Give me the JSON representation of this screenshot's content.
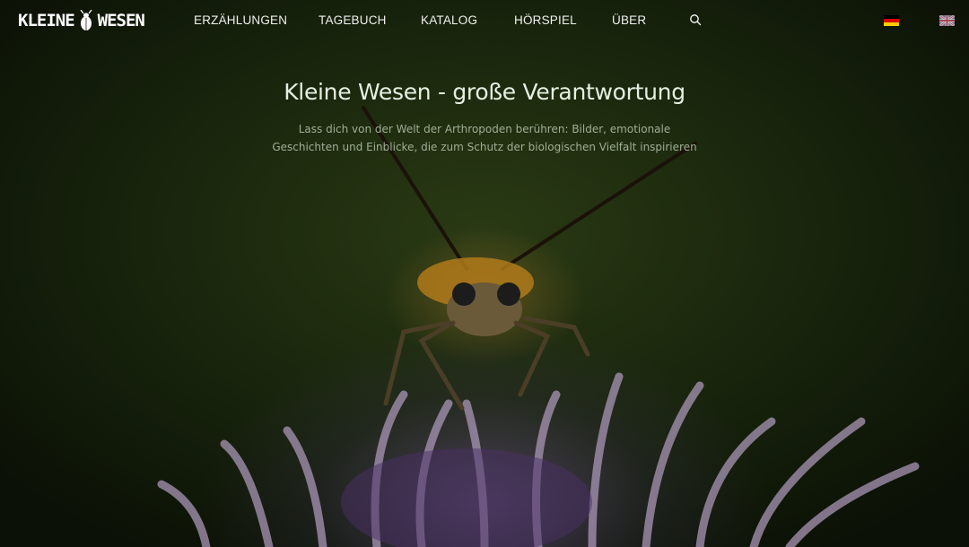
{
  "logo": {
    "text_left": "KLEINE",
    "text_right": "WESEN",
    "icon": "beetle-icon"
  },
  "nav": {
    "items": [
      {
        "label": "ERZÄHLUNGEN"
      },
      {
        "label": "TAGEBUCH"
      },
      {
        "label": "KATALOG"
      },
      {
        "label": "HÖRSPIEL"
      },
      {
        "label": "ÜBER"
      }
    ],
    "search_icon": "search-icon"
  },
  "languages": [
    {
      "code": "de",
      "icon": "german-flag-icon"
    },
    {
      "code": "en",
      "icon": "uk-flag-icon"
    }
  ],
  "hero": {
    "title": "Kleine Wesen - große Verantwortung",
    "subtitle_line1": "Lass dich von der Welt der Arthropoden berühren: Bilder, emotionale",
    "subtitle_line2": "Geschichten und Einblicke, die zum Schutz der biologischen Vielfalt inspirieren"
  },
  "colors": {
    "background": "#18240c",
    "text": "#ffffff",
    "subtitle": "#9fae96"
  }
}
